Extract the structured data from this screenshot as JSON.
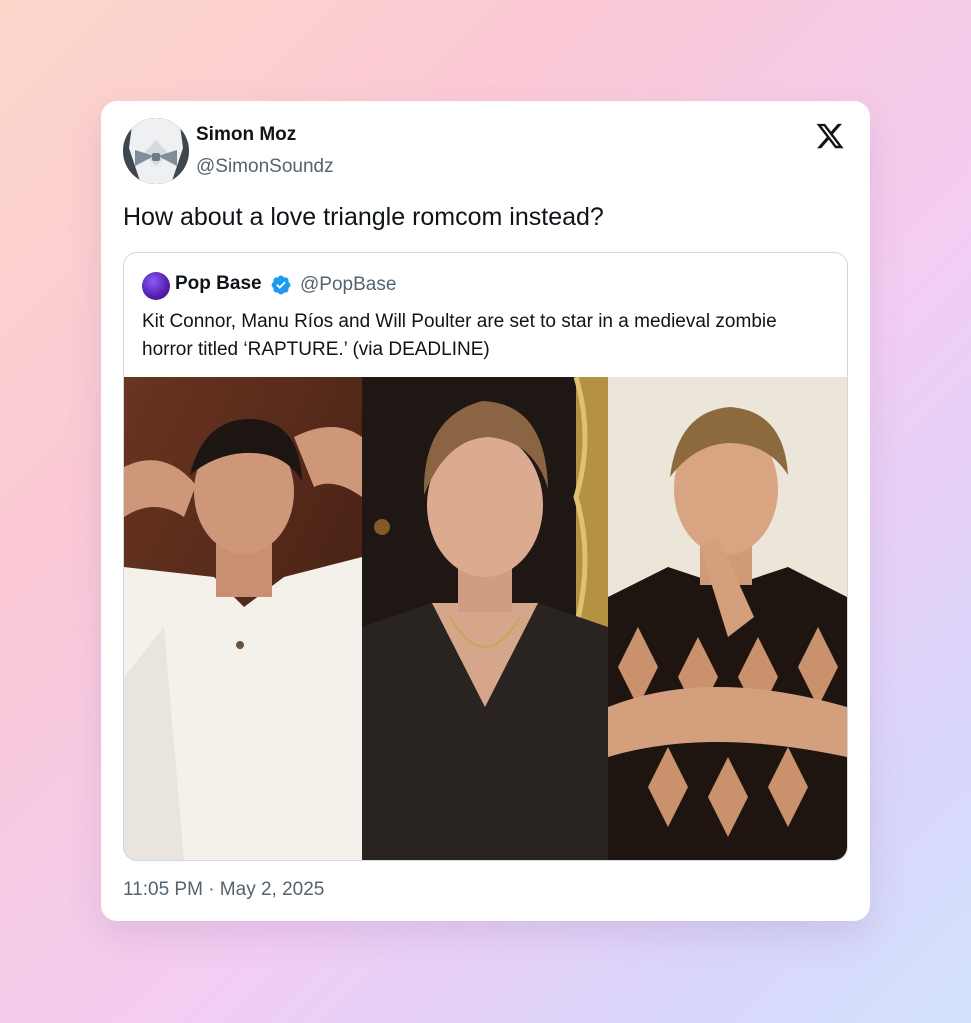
{
  "tweet": {
    "author_name": "Simon Moz",
    "author_handle": "@SimonSoundz",
    "text": "How about a love triangle romcom instead?",
    "timestamp": "11:05 PM · May 2, 2025",
    "platform_icon": "x-logo-icon"
  },
  "quoted_tweet": {
    "author_name": "Pop Base",
    "verified": true,
    "author_handle": "@PopBase",
    "text": "Kit Connor, Manu Ríos and Will Poulter are set to star in a medieval zombie horror titled ‘RAPTURE.’ (via DEADLINE)",
    "photos": [
      "photo-manu-rios",
      "photo-kit-connor",
      "photo-will-poulter"
    ]
  },
  "colors": {
    "text_primary": "#0f1419",
    "text_secondary": "#536471",
    "verified_blue": "#1d9bf0",
    "border": "#cfd9de"
  }
}
